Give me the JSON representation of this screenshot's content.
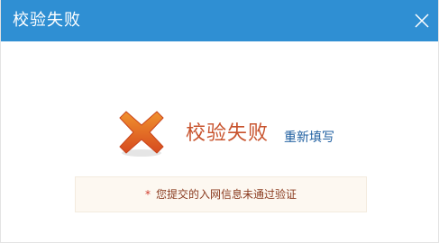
{
  "dialog": {
    "title": "校验失败",
    "close_icon": "close-icon"
  },
  "result": {
    "icon": "error-x-icon",
    "title": "校验失败",
    "retry_link": "重新填写"
  },
  "notice": {
    "marker": "*",
    "message": "您提交的入网信息未通过验证"
  },
  "colors": {
    "titlebar": "#2f8fd3",
    "error_text": "#c8532d",
    "link": "#1f5fa0",
    "notice_bg": "#fdf8f1"
  }
}
